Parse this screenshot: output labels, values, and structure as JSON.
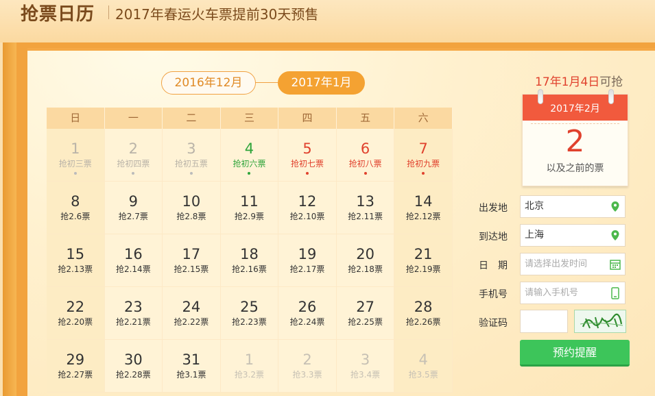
{
  "header": {
    "logo": "抢票日历",
    "subtitle": "2017年春运火车票提前30天预售"
  },
  "months": {
    "prev": "2016年12月",
    "current": "2017年1月"
  },
  "weekdays": [
    "日",
    "一",
    "二",
    "三",
    "四",
    "五",
    "六"
  ],
  "calendar": [
    [
      {
        "day": "1",
        "label": "抢初三票",
        "state": "past",
        "dot": true
      },
      {
        "day": "2",
        "label": "抢初四票",
        "state": "past",
        "dot": true
      },
      {
        "day": "3",
        "label": "抢初五票",
        "state": "past",
        "dot": true
      },
      {
        "day": "4",
        "label": "抢初六票",
        "state": "green",
        "dot": true
      },
      {
        "day": "5",
        "label": "抢初七票",
        "state": "red",
        "dot": true
      },
      {
        "day": "6",
        "label": "抢初八票",
        "state": "red",
        "dot": true
      },
      {
        "day": "7",
        "label": "抢初九票",
        "state": "red",
        "dot": true
      }
    ],
    [
      {
        "day": "8",
        "label": "抢2.6票"
      },
      {
        "day": "9",
        "label": "抢2.7票"
      },
      {
        "day": "10",
        "label": "抢2.8票"
      },
      {
        "day": "11",
        "label": "抢2.9票"
      },
      {
        "day": "12",
        "label": "抢2.10票"
      },
      {
        "day": "13",
        "label": "抢2.11票"
      },
      {
        "day": "14",
        "label": "抢2.12票"
      }
    ],
    [
      {
        "day": "15",
        "label": "抢2.13票"
      },
      {
        "day": "16",
        "label": "抢2.14票"
      },
      {
        "day": "17",
        "label": "抢2.15票"
      },
      {
        "day": "18",
        "label": "抢2.16票"
      },
      {
        "day": "19",
        "label": "抢2.17票"
      },
      {
        "day": "20",
        "label": "抢2.18票"
      },
      {
        "day": "21",
        "label": "抢2.19票"
      }
    ],
    [
      {
        "day": "22",
        "label": "抢2.20票"
      },
      {
        "day": "23",
        "label": "抢2.21票"
      },
      {
        "day": "24",
        "label": "抢2.22票"
      },
      {
        "day": "25",
        "label": "抢2.23票"
      },
      {
        "day": "26",
        "label": "抢2.24票"
      },
      {
        "day": "27",
        "label": "抢2.25票"
      },
      {
        "day": "28",
        "label": "抢2.26票"
      }
    ],
    [
      {
        "day": "29",
        "label": "抢2.27票"
      },
      {
        "day": "30",
        "label": "抢2.28票"
      },
      {
        "day": "31",
        "label": "抢3.1票"
      },
      {
        "day": "1",
        "label": "抢3.2票",
        "state": "next"
      },
      {
        "day": "2",
        "label": "抢3.3票",
        "state": "next"
      },
      {
        "day": "3",
        "label": "抢3.4票",
        "state": "next"
      },
      {
        "day": "4",
        "label": "抢3.5票",
        "state": "next"
      }
    ]
  ],
  "sidebar": {
    "grab_date": "17年1月4日",
    "grab_suffix": "可抢",
    "card_month": "2017年2月",
    "card_day": "2",
    "card_sub": "以及之前的票"
  },
  "form": {
    "from_label": "出发地",
    "from_value": "北京",
    "to_label": "到达地",
    "to_value": "上海",
    "date_label": "日　期",
    "date_placeholder": "请选择出发时间",
    "phone_label": "手机号",
    "phone_placeholder": "请输入手机号",
    "captcha_label": "验证码",
    "submit_label": "预约提醒"
  },
  "colors": {
    "accent": "#f4a232",
    "red": "#e0412d",
    "green": "#2ea43a",
    "submit": "#3dc55a"
  }
}
